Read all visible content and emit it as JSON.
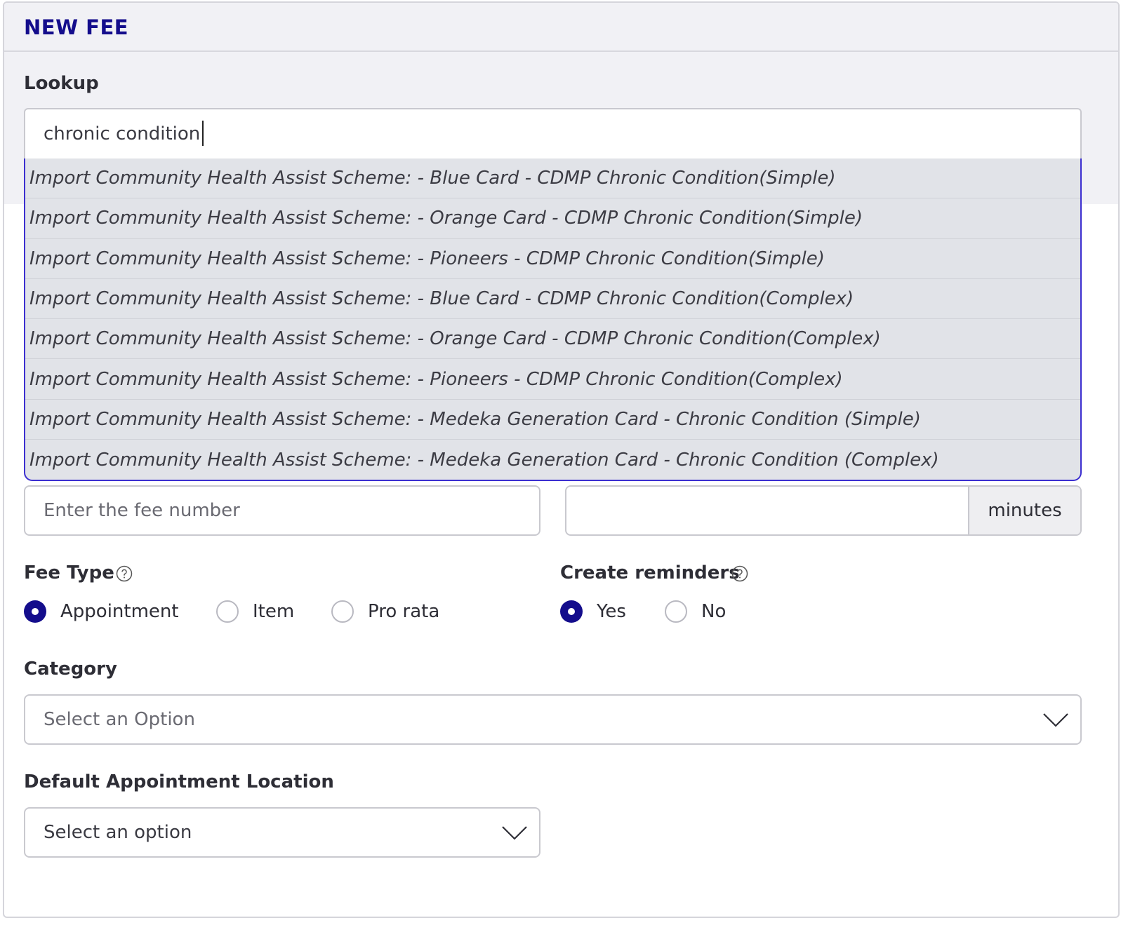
{
  "header": {
    "title": "NEW FEE"
  },
  "lookup": {
    "label": "Lookup",
    "value": "chronic condition",
    "options": [
      "Import Community Health Assist Scheme: - Blue Card - CDMP Chronic Condition(Simple)",
      "Import Community Health Assist Scheme: - Orange Card - CDMP Chronic Condition(Simple)",
      "Import Community Health Assist Scheme: - Pioneers - CDMP Chronic Condition(Simple)",
      "Import Community Health Assist Scheme: - Blue Card - CDMP Chronic Condition(Complex)",
      "Import Community Health Assist Scheme: - Orange Card - CDMP Chronic Condition(Complex)",
      "Import Community Health Assist Scheme: - Pioneers - CDMP Chronic Condition(Complex)",
      "Import Community Health Assist Scheme: - Medeka Generation Card - Chronic Condition (Simple)",
      "Import Community Health Assist Scheme: - Medeka Generation Card - Chronic Condition (Complex)"
    ]
  },
  "fee_number": {
    "placeholder": "Enter the fee number"
  },
  "duration": {
    "value": "",
    "unit": "minutes"
  },
  "fee_type": {
    "label": "Fee Type",
    "options": [
      "Appointment",
      "Item",
      "Pro rata"
    ],
    "selected": "Appointment",
    "help_icon": "question-circle-icon"
  },
  "reminders": {
    "label": "Create reminders",
    "options": [
      "Yes",
      "No"
    ],
    "selected": "Yes",
    "help_icon": "question-circle-icon"
  },
  "category": {
    "label": "Category",
    "placeholder": "Select an Option"
  },
  "location": {
    "label": "Default Appointment Location",
    "placeholder": "Select an option"
  },
  "colors": {
    "accent": "#140d8c",
    "dropdown_border": "#3c2fd0",
    "dropdown_bg": "#e1e3e8",
    "header_bg": "#f1f1f5"
  }
}
